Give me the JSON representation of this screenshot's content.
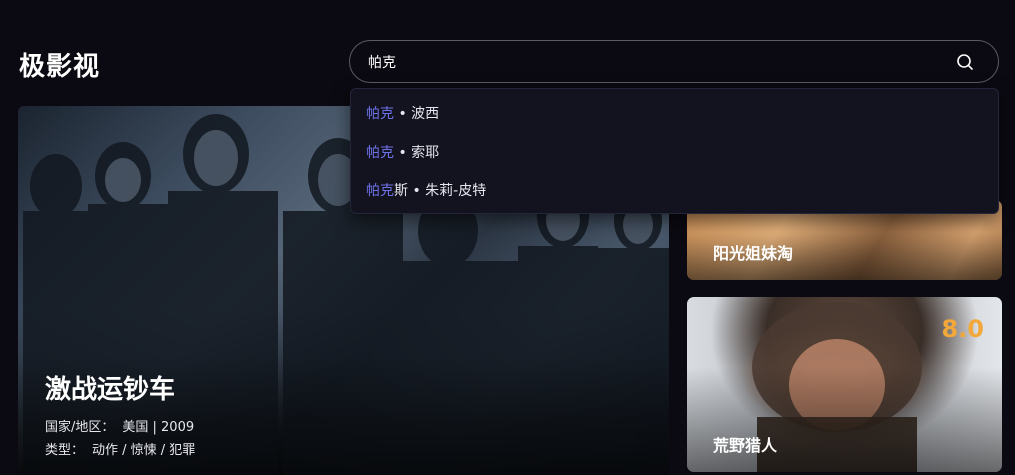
{
  "app": {
    "logo": "极影视"
  },
  "search": {
    "value": "帕克",
    "placeholder": ""
  },
  "suggestions": [
    {
      "highlight": "帕克",
      "rest": " • 波西"
    },
    {
      "highlight": "帕克",
      "rest": " • 索耶"
    },
    {
      "highlight": "帕克",
      "rest": "斯 • 朱莉-皮特"
    }
  ],
  "hero": {
    "title": "激战运钞车",
    "region_label": "国家/地区：",
    "region_value": "美国 | 2009",
    "genre_label": "类型：",
    "genre_value": "动作 / 惊悚 / 犯罪"
  },
  "side_cards": [
    {
      "title": "阳光姐妹淘"
    },
    {
      "title": "荒野猎人",
      "rating": "8.0"
    }
  ],
  "colors": {
    "background": "#0b0a12",
    "highlight": "#6e72e8",
    "rating": "#f2a83b"
  }
}
